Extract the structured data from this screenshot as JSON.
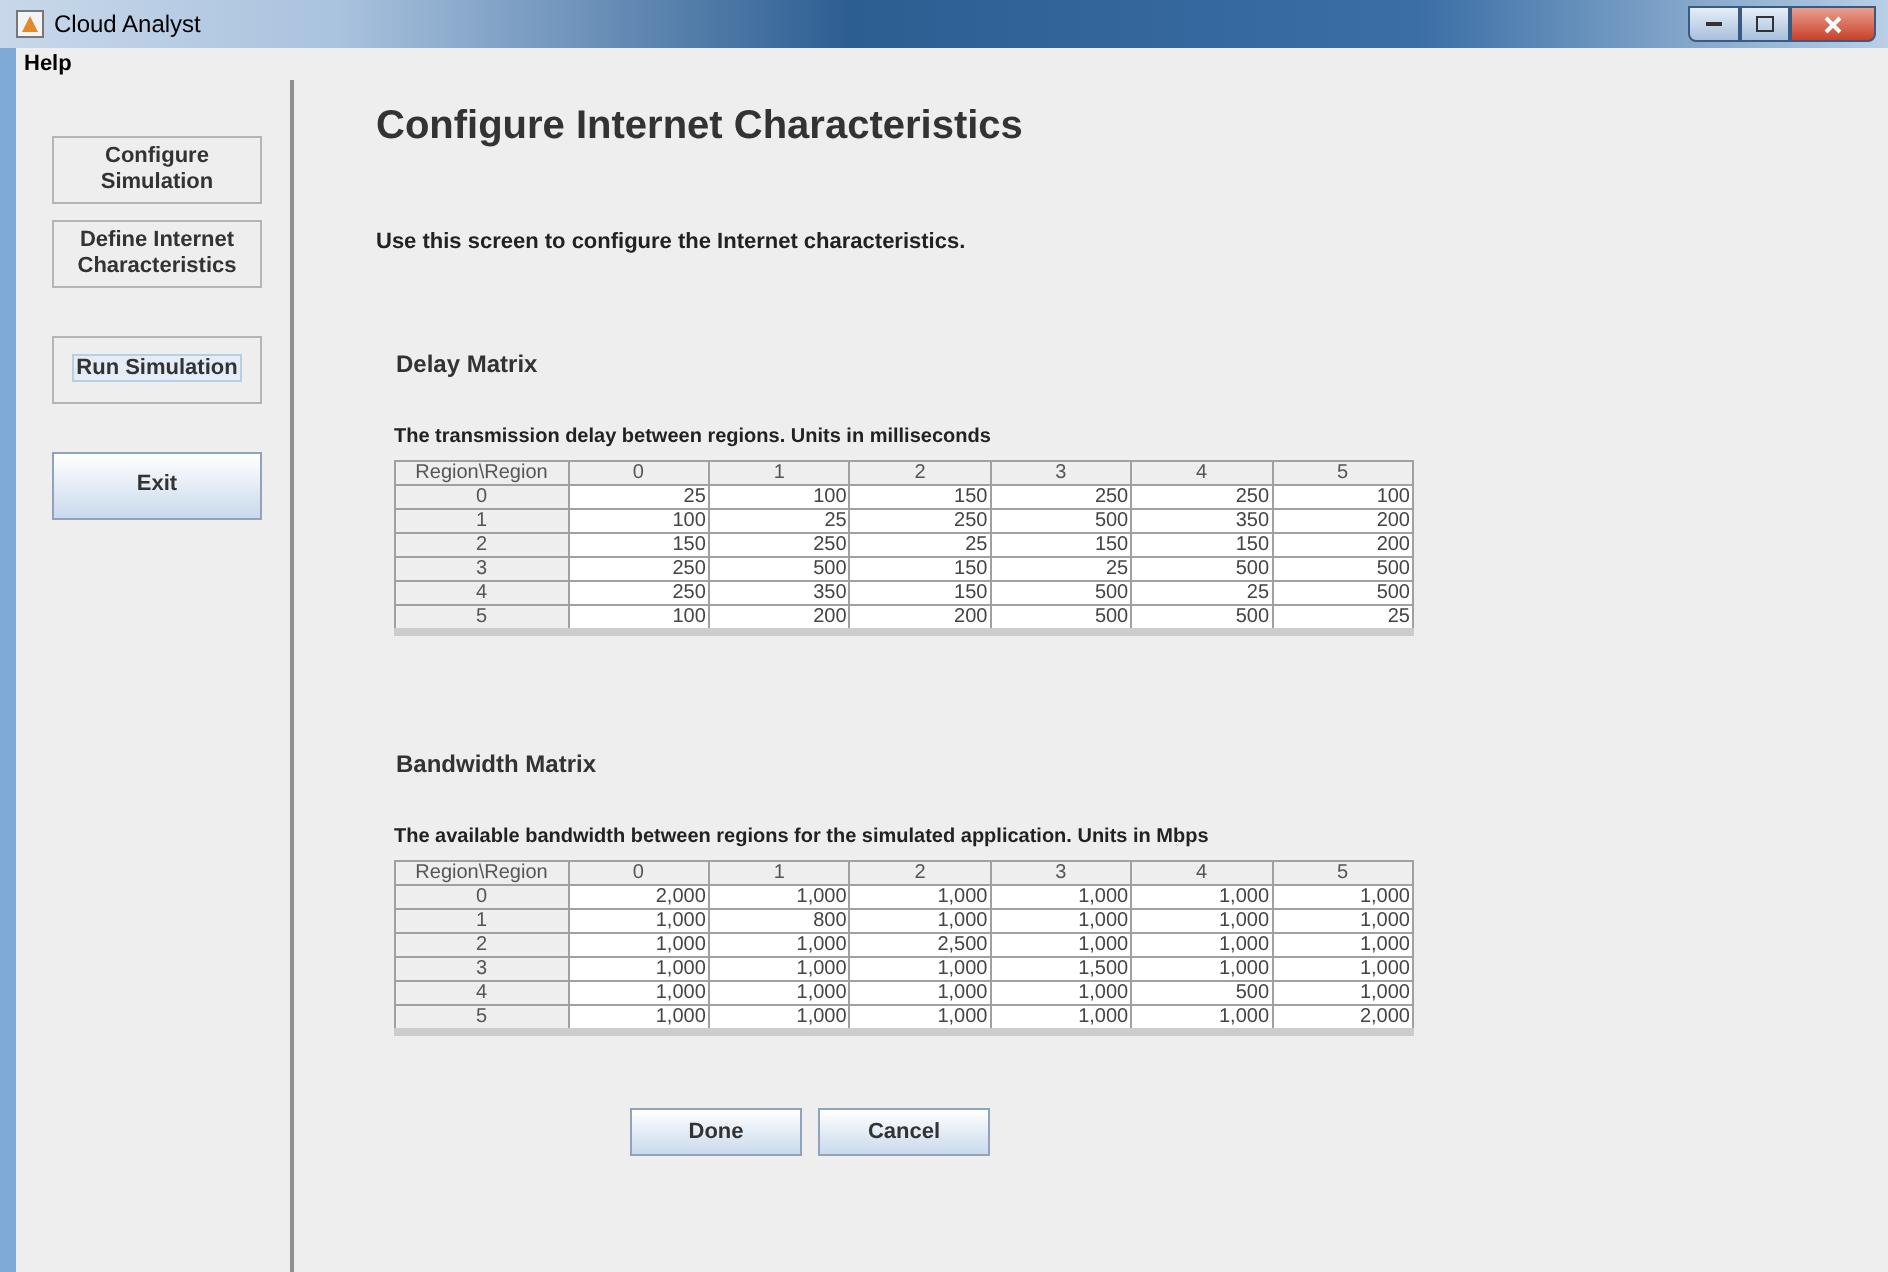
{
  "window": {
    "title": "Cloud Analyst"
  },
  "menu": [
    "Help"
  ],
  "sidebar": {
    "buttons": [
      {
        "label": "Configure Simulation",
        "kind": "plain",
        "focused": false
      },
      {
        "label": "Define Internet Characteristics",
        "kind": "plain",
        "focused": false
      },
      {
        "label": "Run Simulation",
        "kind": "plain",
        "focused": true
      },
      {
        "label": "Exit",
        "kind": "primary",
        "focused": false
      }
    ]
  },
  "page": {
    "title": "Configure Internet Characteristics",
    "description": "Use this screen to configure the Internet characteristics."
  },
  "matrices": [
    {
      "heading": "Delay Matrix",
      "caption": "The transmission delay between regions. Units in milliseconds",
      "columns": [
        "Region\\Region",
        "0",
        "1",
        "2",
        "3",
        "4",
        "5"
      ],
      "rows": [
        [
          "0",
          "25",
          "100",
          "150",
          "250",
          "250",
          "100"
        ],
        [
          "1",
          "100",
          "25",
          "250",
          "500",
          "350",
          "200"
        ],
        [
          "2",
          "150",
          "250",
          "25",
          "150",
          "150",
          "200"
        ],
        [
          "3",
          "250",
          "500",
          "150",
          "25",
          "500",
          "500"
        ],
        [
          "4",
          "250",
          "350",
          "150",
          "500",
          "25",
          "500"
        ],
        [
          "5",
          "100",
          "200",
          "200",
          "500",
          "500",
          "25"
        ]
      ]
    },
    {
      "heading": "Bandwidth Matrix",
      "caption": "The available bandwidth between regions for the simulated application. Units in Mbps",
      "columns": [
        "Region\\Region",
        "0",
        "1",
        "2",
        "3",
        "4",
        "5"
      ],
      "rows": [
        [
          "0",
          "2,000",
          "1,000",
          "1,000",
          "1,000",
          "1,000",
          "1,000"
        ],
        [
          "1",
          "1,000",
          "800",
          "1,000",
          "1,000",
          "1,000",
          "1,000"
        ],
        [
          "2",
          "1,000",
          "1,000",
          "2,500",
          "1,000",
          "1,000",
          "1,000"
        ],
        [
          "3",
          "1,000",
          "1,000",
          "1,000",
          "1,500",
          "1,000",
          "1,000"
        ],
        [
          "4",
          "1,000",
          "1,000",
          "1,000",
          "1,000",
          "500",
          "1,000"
        ],
        [
          "5",
          "1,000",
          "1,000",
          "1,000",
          "1,000",
          "1,000",
          "2,000"
        ]
      ]
    }
  ],
  "actions": [
    "Done",
    "Cancel"
  ]
}
